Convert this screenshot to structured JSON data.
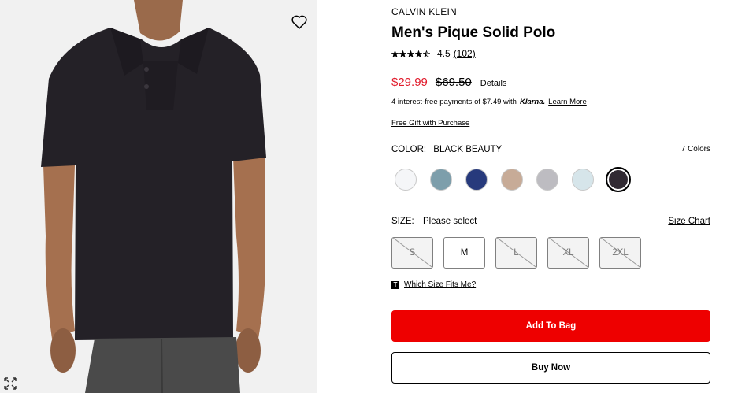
{
  "product": {
    "brand": "CALVIN KLEIN",
    "title": "Men's Pique Solid Polo",
    "rating": 4.5,
    "rating_text": "4.5",
    "review_count": "(102)",
    "price_sale": "$29.99",
    "price_original": "$69.50",
    "details_label": "Details",
    "klarna_text": "4 interest-free payments of $7.49 with",
    "klarna_brand": "Klarna.",
    "klarna_learn": "Learn More",
    "gift_label": "Free Gift with Purchase"
  },
  "color": {
    "label": "COLOR:",
    "selected": "BLACK BEAUTY",
    "count": "7 Colors",
    "swatches": [
      {
        "color": "#f5f6f8",
        "selected": false
      },
      {
        "color": "#7d9eab",
        "selected": false
      },
      {
        "color": "#273a7c",
        "selected": false
      },
      {
        "color": "#c7ab97",
        "selected": false
      },
      {
        "color": "#bdbcc1",
        "selected": false
      },
      {
        "color": "#d6e5ea",
        "selected": false
      },
      {
        "color": "#312a33",
        "selected": true
      }
    ]
  },
  "size": {
    "label": "SIZE:",
    "prompt": "Please select",
    "chart_label": "Size Chart",
    "options": [
      {
        "label": "S",
        "available": false
      },
      {
        "label": "M",
        "available": true
      },
      {
        "label": "L",
        "available": false
      },
      {
        "label": "XL",
        "available": false
      },
      {
        "label": "2XL",
        "available": false
      }
    ],
    "fit_label": "Which Size Fits Me?"
  },
  "actions": {
    "add_to_bag": "Add To Bag",
    "buy_now": "Buy Now"
  },
  "icons": {
    "favorite": "heart-icon",
    "expand": "expand-icon",
    "fit": "size-fit-icon"
  },
  "colors": {
    "sale_price": "#e11a2b",
    "primary_button": "#ee0000"
  }
}
